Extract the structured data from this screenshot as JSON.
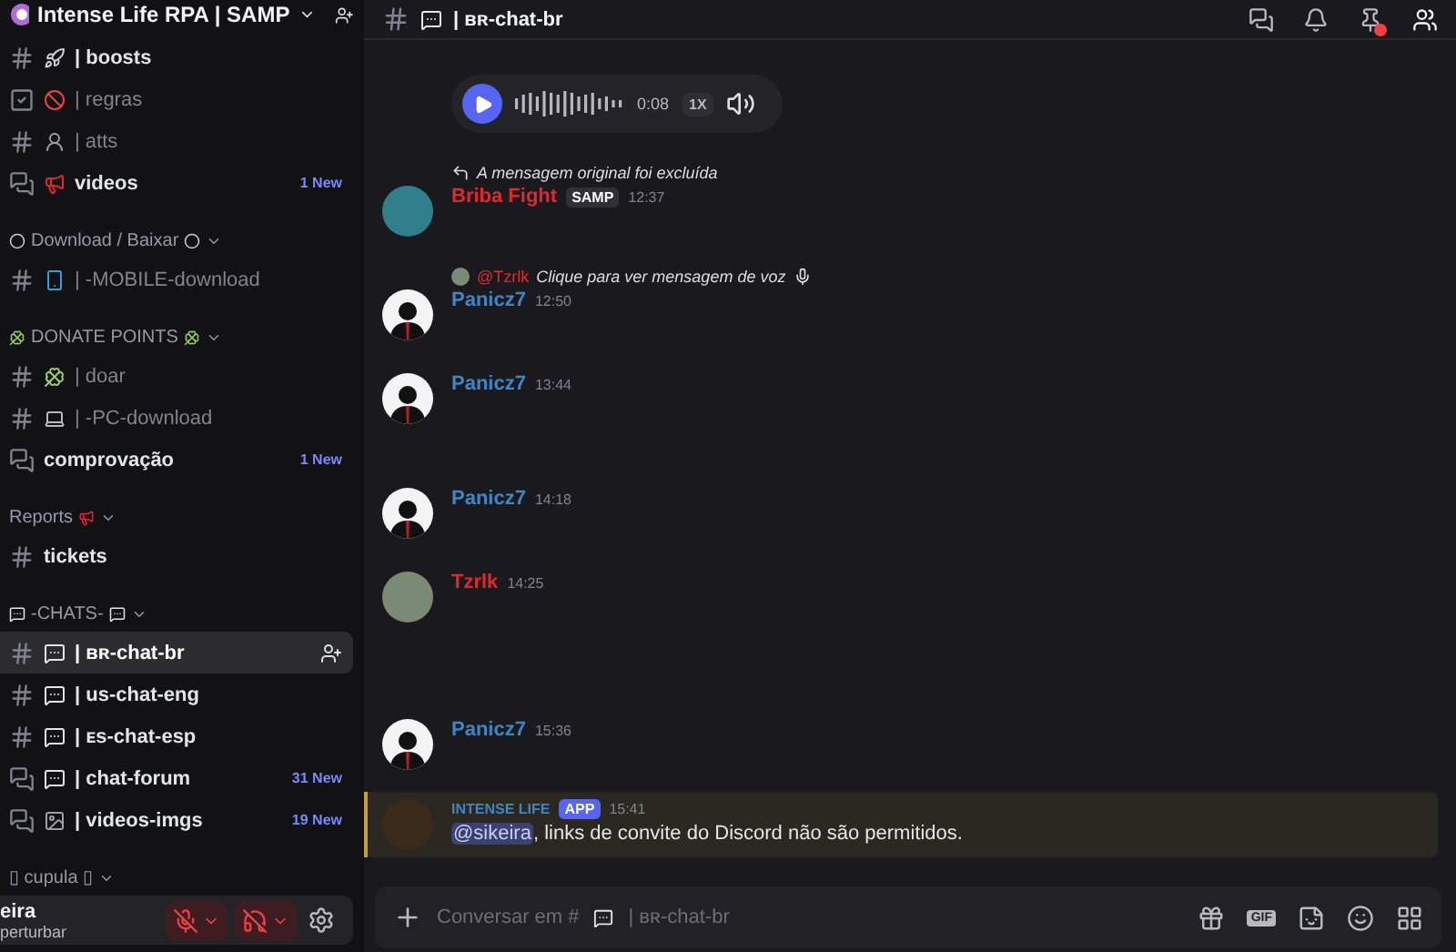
{
  "server": {
    "name": "Intense Life RPA | SAMP"
  },
  "sidebar": {
    "sections": [
      {
        "channels": [
          {
            "kind": "text",
            "emoji": {
              "kind": "rocket"
            },
            "name": "| boosts",
            "unread": true,
            "selected": false
          },
          {
            "kind": "rules",
            "emoji": {
              "kind": "ban"
            },
            "name": "| regras",
            "unread": false,
            "selected": false
          },
          {
            "kind": "text",
            "emoji": {
              "kind": "person"
            },
            "name": "| atts",
            "unread": false,
            "selected": false
          },
          {
            "kind": "forum",
            "emoji": {
              "kind": "megaphone"
            },
            "name": "videos",
            "unread": true,
            "badge": "1 New",
            "selected": false
          }
        ]
      },
      {
        "category": {
          "label": "Download / Baixar",
          "prefix": {
            "kind": "orb"
          },
          "suffix": {
            "kind": "orb"
          }
        },
        "channels": [
          {
            "kind": "text",
            "emoji": {
              "kind": "phone"
            },
            "name": "| -MOBILE-download",
            "unread": false,
            "selected": false
          }
        ]
      },
      {
        "category": {
          "label": "DONATE POINTS",
          "prefix": {
            "kind": "clover"
          },
          "suffix": {
            "kind": "clover"
          }
        },
        "channels": [
          {
            "kind": "text",
            "emoji": {
              "kind": "clover"
            },
            "name": "| doar",
            "unread": false,
            "selected": false
          },
          {
            "kind": "text",
            "emoji": {
              "kind": "laptop"
            },
            "name": "| -PC-download",
            "unread": false,
            "selected": false
          },
          {
            "kind": "forum",
            "name": "comprovação",
            "unread": true,
            "badge": "1 New",
            "selected": false
          }
        ]
      },
      {
        "category": {
          "label": "Reports",
          "suffix": {
            "kind": "megaphone"
          }
        },
        "channels": [
          {
            "kind": "text",
            "name": "tickets",
            "unread": true,
            "selected": false
          }
        ]
      },
      {
        "category": {
          "label": "-CHATS-",
          "prefix": {
            "kind": "bubble"
          },
          "suffix": {
            "kind": "bubble"
          }
        },
        "channels": [
          {
            "kind": "text",
            "emoji": {
              "kind": "chat"
            },
            "name": "| ʙʀ-chat-br",
            "unread": true,
            "selected": true
          },
          {
            "kind": "text",
            "emoji": {
              "kind": "chat"
            },
            "name": "| us-chat-eng",
            "unread": true,
            "selected": false
          },
          {
            "kind": "text",
            "emoji": {
              "kind": "chat"
            },
            "name": "| ᴇs-chat-esp",
            "unread": true,
            "selected": false
          },
          {
            "kind": "forum",
            "emoji": {
              "kind": "chat"
            },
            "name": "| chat-forum",
            "unread": true,
            "badge": "31 New",
            "selected": false
          },
          {
            "kind": "forum",
            "emoji": {
              "kind": "image"
            },
            "name": "| videos-imgs",
            "unread": true,
            "badge": "19 New",
            "selected": false
          }
        ]
      },
      {
        "category": {
          "label": "▯ cupula ▯"
        }
      }
    ]
  },
  "user_panel": {
    "name": "eira",
    "status": "perturbar",
    "mic_muted": true,
    "deafened": true
  },
  "header": {
    "channel": "| ʙʀ-chat-br",
    "pins_alert": true
  },
  "messages": [
    {
      "kind": "voice",
      "time": "0:08",
      "speed": "1X"
    },
    {
      "kind": "message",
      "reply": {
        "text": "A mensagem original foi excluída",
        "voice": false
      },
      "author": "Briba Fight",
      "color": "#e0282e",
      "tag": "SAMP",
      "avatar": {
        "kind": "green"
      },
      "time": "12:37"
    },
    {
      "kind": "message",
      "reply": {
        "mention": "@Tzrlk",
        "text": "Clique para ver mensagem de voz",
        "voice": true
      },
      "author": "Panicz7",
      "color": "#3f86c6",
      "avatar": {
        "kind": "suit"
      },
      "time": "12:50"
    },
    {
      "kind": "message",
      "author": "Panicz7",
      "color": "#3f86c6",
      "avatar": {
        "kind": "suit"
      },
      "time": "13:44"
    },
    {
      "kind": "message",
      "author": "Panicz7",
      "color": "#3f86c6",
      "avatar": {
        "kind": "suit"
      },
      "time": "14:18"
    },
    {
      "kind": "message",
      "author": "Tzrlk",
      "color": "#e0282e",
      "avatar": {
        "kind": "photo"
      },
      "time": "14:25"
    },
    {
      "kind": "message",
      "author": "Panicz7",
      "color": "#3f86c6",
      "avatar": {
        "kind": "suit"
      },
      "time": "15:36"
    },
    {
      "kind": "system",
      "author": "INTENSE LIFE",
      "tag": "APP",
      "time": "15:41",
      "mention": "@sikeira",
      "text": ", links de convite do Discord não são permitidos."
    }
  ],
  "composer": {
    "placeholder_prefix": "Conversar em #",
    "placeholder_channel": "| ʙʀ-chat-br",
    "gif_label": "GIF"
  }
}
